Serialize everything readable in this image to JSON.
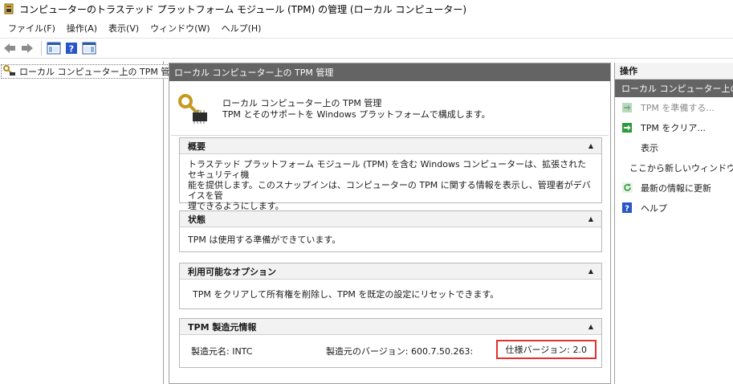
{
  "window": {
    "title": "コンピューターのトラステッド プラットフォーム モジュール (TPM) の管理 (ローカル コンピューター)"
  },
  "menu": [
    "ファイル(F)",
    "操作(A)",
    "表示(V)",
    "ウィンドウ(W)",
    "ヘルプ(H)"
  ],
  "toolbar": {
    "icons": [
      "back-arrow-icon",
      "forward-arrow-icon",
      "show-hide-console-tree-icon",
      "help-icon",
      "show-hide-action-pane-icon"
    ]
  },
  "tree": {
    "root_label": "ローカル コンピューター上の TPM 管理"
  },
  "center": {
    "header": "ローカル コンピューター上の TPM 管理",
    "intro_line1": "ローカル コンピューター上の TPM 管理",
    "intro_line2": "TPM とそのサポートを Windows プラットフォームで構成します。",
    "sections": {
      "overview": {
        "title": "概要",
        "body_line1": "トラステッド プラットフォーム モジュール (TPM) を含む Windows コンピューターは、拡張されたセキュリティ機",
        "body_line2": "能を提供します。このスナップインは、コンピューターの TPM に関する情報を表示し、管理者がデバイスを管",
        "body_line3": "理できるようにします。"
      },
      "status": {
        "title": "状態",
        "body": "TPM は使用する準備ができています。"
      },
      "options": {
        "title": "利用可能なオプション",
        "body": "TPM をクリアして所有権を削除し、TPM を既定の設定にリセットできます。"
      },
      "manufacturer": {
        "title": "TPM 製造元情報",
        "name": "製造元名: INTC",
        "version": "製造元のバージョン: 600.7.50.263:",
        "spec_version": "仕様バージョン: 2.0"
      }
    }
  },
  "actions": {
    "header": "操作",
    "group_title": "ローカル コンピューター上の TPM",
    "items": [
      {
        "label": "TPM を準備する...",
        "icon": "green-arrow-icon",
        "enabled": false
      },
      {
        "label": "TPM をクリア...",
        "icon": "green-arrow-icon",
        "enabled": true
      },
      {
        "label": "表示",
        "icon": "",
        "enabled": true
      },
      {
        "label": "ここから新しいウィンドウ",
        "icon": "",
        "enabled": true
      },
      {
        "label": "最新の情報に更新",
        "icon": "refresh-icon",
        "enabled": true
      },
      {
        "label": "ヘルプ",
        "icon": "help-icon",
        "enabled": true
      }
    ]
  },
  "colors": {
    "header_bg": "#646464",
    "highlight_border": "#e53030",
    "action_arrow": "#2e9a3a",
    "help_blue": "#2a55c8"
  }
}
